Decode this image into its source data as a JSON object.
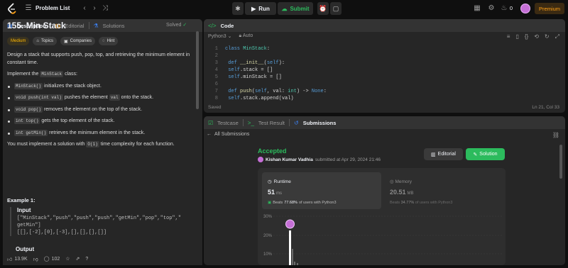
{
  "nav": {
    "problem_list": "Problem List",
    "run": "Run",
    "submit": "Submit",
    "fire_count": "0",
    "premium": "Premium"
  },
  "description": {
    "tabs": [
      "Description",
      "Editorial",
      "Solutions"
    ],
    "title": "155. Min Stack",
    "solved": "Solved",
    "tags": [
      "Medium",
      "Topics",
      "Companies",
      "Hint"
    ],
    "intro": "Design a stack that supports push, pop, top, and retrieving the minimum element in constant time.",
    "implement_prefix": "Implement the ",
    "implement_code": "MinStack",
    "implement_suffix": " class:",
    "bullets": [
      {
        "code": "MinStack()",
        "text": " initializes the stack object."
      },
      {
        "code": "void push(int val)",
        "text": " pushes the element ",
        "code2": "val",
        "text2": " onto the stack."
      },
      {
        "code": "void pop()",
        "text": " removes the element on the top of the stack."
      },
      {
        "code": "int top()",
        "text": " gets the top element of the stack."
      },
      {
        "code": "int getMin()",
        "text": " retrieves the minimum element in the stack."
      }
    ],
    "complexity_prefix": "You must implement a solution with ",
    "complexity_code": "O(1)",
    "complexity_suffix": " time complexity for each function.",
    "example_title": "Example 1:",
    "input_label": "Input",
    "input_line1": "[\"MinStack\",\"push\",\"push\",\"push\",\"getMin\",\"pop\",\"top\",\"",
    "input_line2": "getMin\"]",
    "input_line3": "[[],[-2],[0],[-3],[],[],[],[]]",
    "output_label": "Output",
    "likes": "13.9K",
    "comments": "102"
  },
  "code": {
    "tab": "Code",
    "language": "Python3",
    "auto": "Auto",
    "saved": "Saved",
    "position": "Ln 21, Col 33",
    "lines": [
      {
        "n": "1",
        "html": "class MinStack:"
      },
      {
        "n": "2",
        "html": ""
      },
      {
        "n": "3",
        "html": "    def __init__(self):"
      },
      {
        "n": "4",
        "html": "        self.stack = []"
      },
      {
        "n": "5",
        "html": "        self.minStack = []"
      },
      {
        "n": "6",
        "html": ""
      },
      {
        "n": "7",
        "html": "    def push(self, val: int) -> None:"
      },
      {
        "n": "8",
        "html": "        self.stack.append(val)"
      }
    ]
  },
  "result": {
    "tabs": [
      "Testcase",
      "Test Result",
      "Submissions"
    ],
    "back_label": "All Submissions",
    "status": "Accepted",
    "user": "Kishan Kumar Vadhia",
    "submitted": "submitted at Apr 29, 2024 21:46",
    "editorial_btn": "Editorial",
    "solution_btn": "Solution",
    "runtime_label": "Runtime",
    "runtime_value": "51",
    "runtime_unit": "ms",
    "runtime_beats_prefix": "Beats",
    "runtime_beats_pct": "77.68%",
    "runtime_beats_suffix": "of users with Python3",
    "memory_label": "Memory",
    "memory_value": "20.51",
    "memory_unit": "MB",
    "memory_beats_prefix": "Beats",
    "memory_beats_pct": "34.77%",
    "memory_beats_suffix": "of users with Python3",
    "chart_ticks": [
      "30%",
      "20%",
      "10%"
    ]
  },
  "colors": {
    "accent_green": "#2cbb5d",
    "accent_orange": "#ffa116",
    "medium": "#ffb800"
  }
}
